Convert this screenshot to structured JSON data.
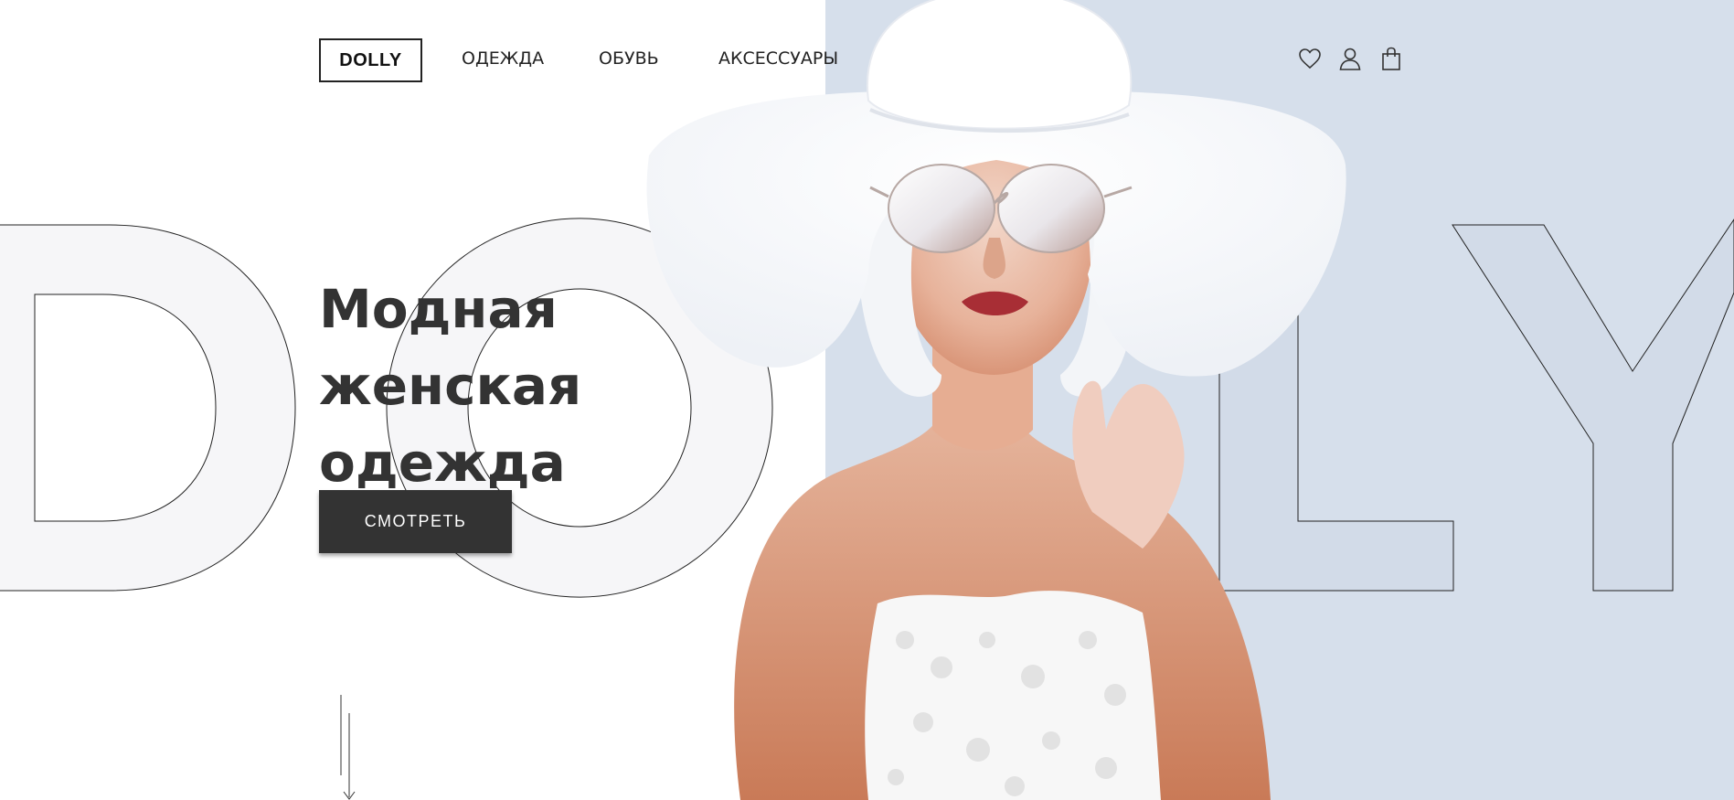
{
  "header": {
    "logo": "DOLLY",
    "nav": [
      {
        "label": "ОДЕЖДА"
      },
      {
        "label": "ОБУВЬ"
      },
      {
        "label": "АКСЕССУАРЫ"
      }
    ],
    "icons": [
      "heart-icon",
      "user-icon",
      "shopping-bag-icon"
    ]
  },
  "hero": {
    "title": "Модная женская одежда",
    "cta_label": "СМОТРЕТЬ"
  },
  "background_word": "DOLLY",
  "colors": {
    "right_panel": "#d6dfeb",
    "letter_fill_light": "#f6f6f8",
    "letter_fill_blue": "#d2dbe8",
    "button_bg": "#333333",
    "text_dark": "#333333"
  }
}
